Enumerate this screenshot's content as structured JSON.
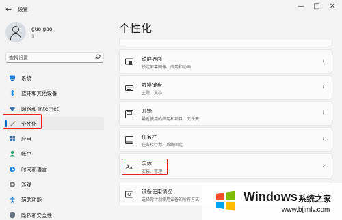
{
  "window": {
    "title": "设置",
    "back_glyph": "←",
    "min_glyph": "—",
    "max_glyph": "□",
    "close_glyph": "✕"
  },
  "profile": {
    "name": "guo gao",
    "sub": "1"
  },
  "search": {
    "placeholder": "查找设置"
  },
  "nav": {
    "items": [
      {
        "label": "系统",
        "icon": "monitor-icon"
      },
      {
        "label": "蓝牙和其他设备",
        "icon": "bluetooth-icon"
      },
      {
        "label": "网络和 Internet",
        "icon": "wifi-icon"
      },
      {
        "label": "个性化",
        "icon": "pen-icon",
        "selected": true
      },
      {
        "label": "应用",
        "icon": "apps-icon"
      },
      {
        "label": "帐户",
        "icon": "person-icon"
      },
      {
        "label": "时间和语言",
        "icon": "globe-clock-icon"
      },
      {
        "label": "游戏",
        "icon": "gamepad-icon"
      },
      {
        "label": "辅助功能",
        "icon": "accessibility-icon"
      },
      {
        "label": "隐私和安全性",
        "icon": "shield-icon"
      }
    ]
  },
  "main": {
    "title": "个性化",
    "cards": [
      {
        "title": "锁屏界面",
        "desc": "锁定屏幕图像、应用和动画",
        "icon": "lock-screen-icon"
      },
      {
        "title": "触摸键盘",
        "desc": "主题、大小",
        "icon": "keyboard-icon"
      },
      {
        "title": "开始",
        "desc": "最近使用的应用和项目、文件夹",
        "icon": "start-icon"
      },
      {
        "title": "任务栏",
        "desc": "任务栏行为、系统固定",
        "icon": "taskbar-icon"
      },
      {
        "title": "字体",
        "desc": "安装、管理",
        "icon": "font-icon"
      },
      {
        "title": "设备使用情况",
        "desc": "选择你计划使用设备的所有方式",
        "icon": "device-usage-icon"
      }
    ]
  },
  "watermark": {
    "brand": "Windows",
    "cn": "系统之家",
    "url": "www.bjjmlv.com"
  },
  "colors": {
    "accent": "#0067c0",
    "highlight_box": "#e0271a"
  }
}
